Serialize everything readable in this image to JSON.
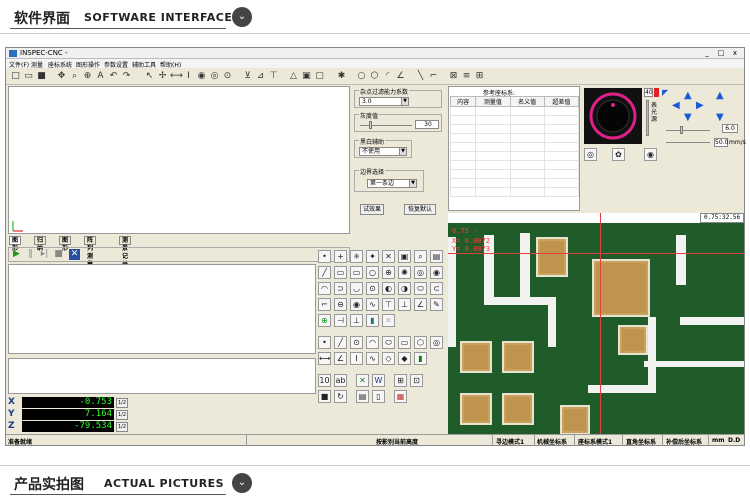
{
  "banner_top": {
    "cn": "软件界面",
    "en": "SOFTWARE INTERFACE"
  },
  "banner_bottom": {
    "cn": "产品实拍图",
    "en": "ACTUAL PICTURES"
  },
  "window": {
    "title": "INSPEC-CNC - ",
    "minimize": "_",
    "maximize": "□",
    "close": "x"
  },
  "menu": [
    "文件(F)",
    "测量",
    "座标系统",
    "图形操作",
    "参数设置",
    "辅助工具",
    "帮助(H)"
  ],
  "filter_panel": {
    "noise_label": "杂点过滤能力系数",
    "noise_value": "3.0",
    "gray_label": "灰度值",
    "gray_value": "30",
    "bw_label": "黑白辅助",
    "bw_value": "不使用",
    "edge_label": "边界选择",
    "edge_value": "第一条边",
    "test_button": "试效果",
    "reset_button": "恢复默认"
  },
  "ref_table": {
    "title": "参考座标系:",
    "columns": [
      "内容",
      "测量值",
      "名义值",
      "超差值"
    ]
  },
  "tabs": [
    "图形",
    "归纳",
    "图形",
    "阵列测量",
    "测景记录"
  ],
  "light": {
    "value": "40",
    "side_label": "表光源"
  },
  "speed": {
    "value": "6.0",
    "max": "50.0",
    "unit": "mm/s"
  },
  "dro": {
    "x_label": "X",
    "x_value": "-0.753",
    "y_label": "Y",
    "y_value": "7.164",
    "z_label": "Z",
    "z_value": "-79.534",
    "half": "1/2"
  },
  "camera": {
    "line1": "0.75 -",
    "line2": "X= 0.0072",
    "line3": "Y= 0.0073",
    "corner": "0.75:32.56"
  },
  "status": {
    "left": "准备就绪",
    "mid": "按影别当前高度",
    "mode1": "寻边模式1",
    "mode2": "机械坐标系",
    "mode3": "座标系模式1",
    "mode4": "直角坐标系",
    "mode5": "补偿后坐标系",
    "unit": "mm",
    "deg": "D.D"
  },
  "colors": {
    "dro_text": "#2cff2c",
    "camera_bg": "#1f5c2a",
    "cross": "#e04040"
  }
}
